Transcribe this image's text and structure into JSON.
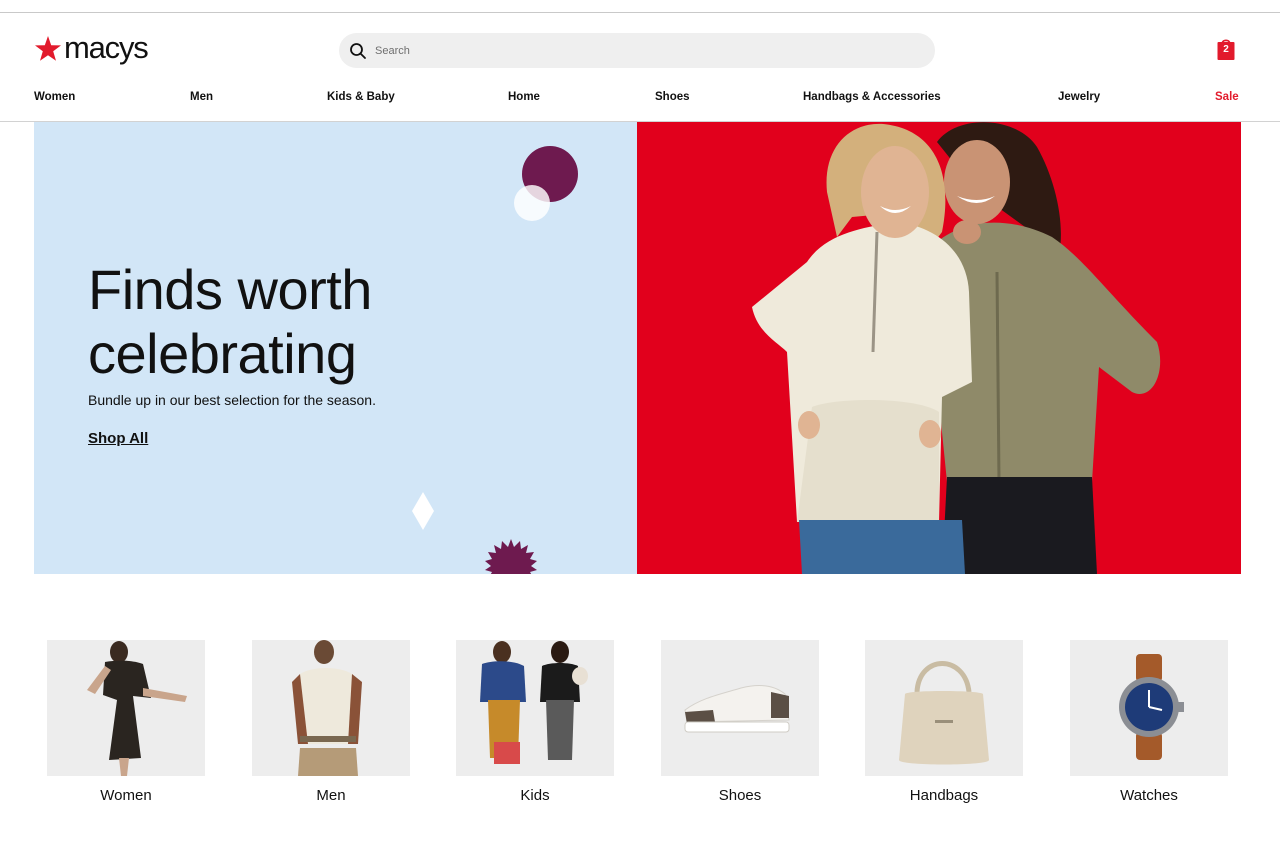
{
  "brand": {
    "name": "macy's",
    "logo_text": "macys",
    "accent_color": "#e21a2c"
  },
  "search": {
    "placeholder": "Search",
    "icon": "search-icon"
  },
  "bag": {
    "count": "2",
    "icon": "shopping-bag-icon",
    "color": "#e21a2c"
  },
  "nav": {
    "items": [
      {
        "label": "Women"
      },
      {
        "label": "Men"
      },
      {
        "label": "Kids & Baby"
      },
      {
        "label": "Home"
      },
      {
        "label": "Shoes"
      },
      {
        "label": "Handbags & Accessories"
      },
      {
        "label": "Jewelry"
      },
      {
        "label": "Sale",
        "color": "#e21a2c"
      }
    ]
  },
  "hero": {
    "title": "Finds worth celebrating",
    "subtitle": "Bundle up in our best selection for the season.",
    "cta": "Shop All",
    "left_bg": "#d2e6f7",
    "right_bg": "#e1001c"
  },
  "categories": [
    {
      "label": "Women"
    },
    {
      "label": "Men"
    },
    {
      "label": "Kids"
    },
    {
      "label": "Shoes"
    },
    {
      "label": "Handbags"
    },
    {
      "label": "Watches"
    }
  ]
}
